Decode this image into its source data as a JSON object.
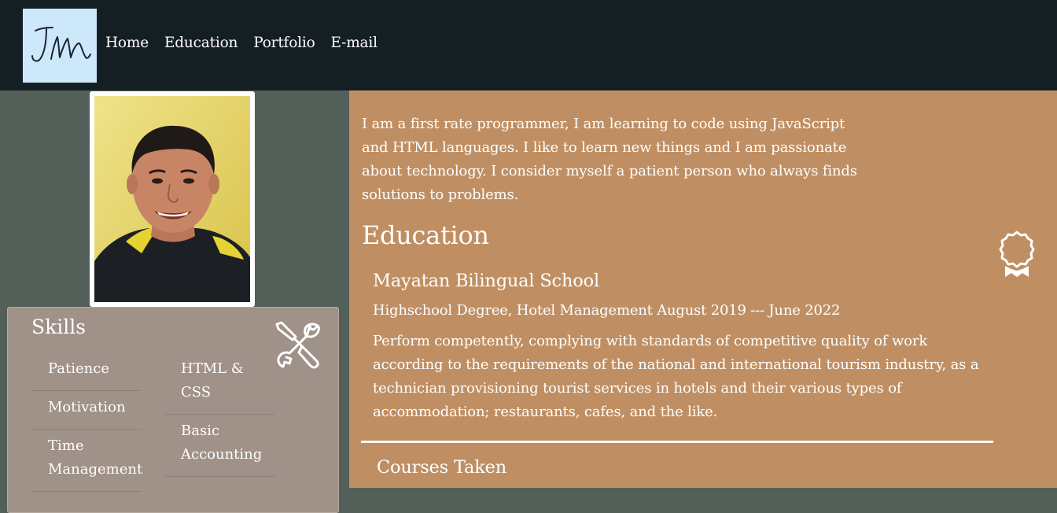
{
  "header": {
    "logo_icon": "jm-signature-logo",
    "nav": [
      "Home",
      "Education",
      "Portfolio",
      "E-mail"
    ]
  },
  "profile": {
    "photo_icon": "profile-photo"
  },
  "skills": {
    "title": "Skills",
    "icon": "wrench-screwdriver-icon",
    "column_one": [
      "Patience",
      "Motivation",
      "Time Management"
    ],
    "column_two": [
      "HTML & CSS",
      "Basic Accounting"
    ]
  },
  "about": {
    "text": "I am a first rate programmer, I am learning to code using JavaScript and HTML languages. I like to learn new things and I am passionate about technology. I consider myself a patient person who always finds solutions to problems."
  },
  "education": {
    "heading": "Education",
    "icon": "award-ribbon-icon",
    "school": "Mayatan Bilingual School",
    "degree": "Highschool Degree, Hotel Management August 2019 --- June 2022",
    "description": "Perform competently, complying with standards of competitive quality of work according to the requirements of the national and international tourism industry, as a technician provisioning tourist services in hotels and their various types of accommodation; restaurants, cafes, and the like.",
    "courses_heading": "Courses Taken"
  },
  "colors": {
    "header_bg": "#141f24",
    "logo_bg": "#cde8fb",
    "left_bg": "#536059",
    "skills_card_bg": "#a09189",
    "right_bg": "#bf8f63",
    "text": "#ffffff"
  }
}
